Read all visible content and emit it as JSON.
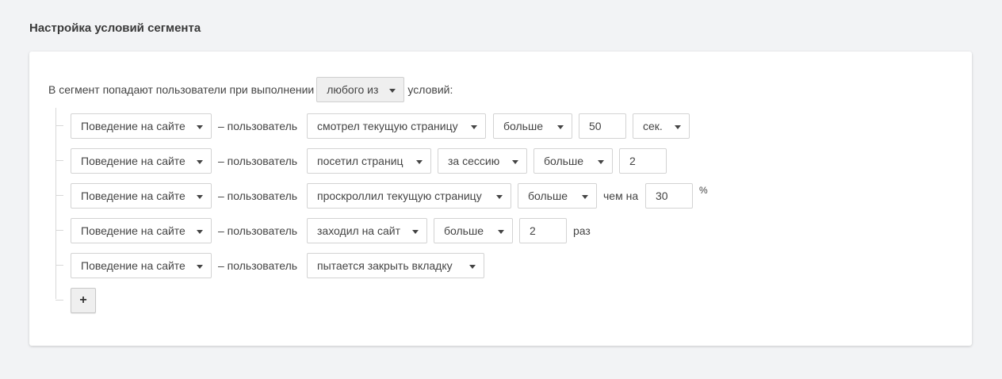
{
  "title": "Настройка условий сегмента",
  "intro": {
    "prefix": "В сегмент попадают пользователи при выполнении",
    "match_select": "любого из",
    "suffix": "условий:"
  },
  "connector": "– пользователь",
  "rows": [
    {
      "category": "Поведение на сайте",
      "action": "смотрел текущую страницу",
      "comparison": "больше",
      "value": "50",
      "unit": "сек."
    },
    {
      "category": "Поведение на сайте",
      "action": "посетил страниц",
      "scope": "за сессию",
      "comparison": "больше",
      "value": "2"
    },
    {
      "category": "Поведение на сайте",
      "action": "проскроллил текущую страницу",
      "comparison": "больше",
      "between": "чем на",
      "value": "30",
      "unit": "%"
    },
    {
      "category": "Поведение на сайте",
      "action": "заходил на сайт",
      "comparison": "больше",
      "value": "2",
      "unit": "раз"
    },
    {
      "category": "Поведение на сайте",
      "action": "пытается закрыть вкладку"
    }
  ],
  "add_label": "+",
  "icons": {
    "caret": "caret-down-icon",
    "add": "plus-icon"
  }
}
